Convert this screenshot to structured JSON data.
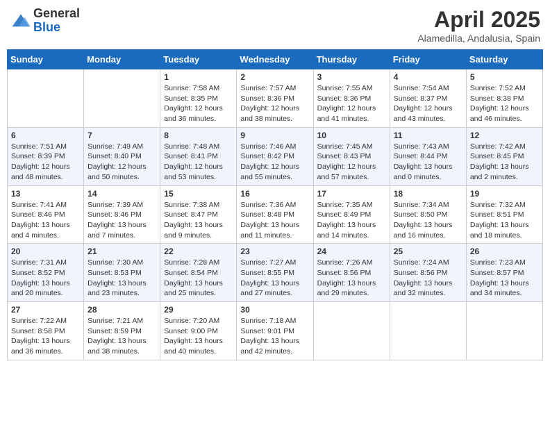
{
  "header": {
    "logo_general": "General",
    "logo_blue": "Blue",
    "month_title": "April 2025",
    "location": "Alamedilla, Andalusia, Spain"
  },
  "weekdays": [
    "Sunday",
    "Monday",
    "Tuesday",
    "Wednesday",
    "Thursday",
    "Friday",
    "Saturday"
  ],
  "weeks": [
    [
      {
        "day": "",
        "sunrise": "",
        "sunset": "",
        "daylight": ""
      },
      {
        "day": "",
        "sunrise": "",
        "sunset": "",
        "daylight": ""
      },
      {
        "day": "1",
        "sunrise": "Sunrise: 7:58 AM",
        "sunset": "Sunset: 8:35 PM",
        "daylight": "Daylight: 12 hours and 36 minutes."
      },
      {
        "day": "2",
        "sunrise": "Sunrise: 7:57 AM",
        "sunset": "Sunset: 8:36 PM",
        "daylight": "Daylight: 12 hours and 38 minutes."
      },
      {
        "day": "3",
        "sunrise": "Sunrise: 7:55 AM",
        "sunset": "Sunset: 8:36 PM",
        "daylight": "Daylight: 12 hours and 41 minutes."
      },
      {
        "day": "4",
        "sunrise": "Sunrise: 7:54 AM",
        "sunset": "Sunset: 8:37 PM",
        "daylight": "Daylight: 12 hours and 43 minutes."
      },
      {
        "day": "5",
        "sunrise": "Sunrise: 7:52 AM",
        "sunset": "Sunset: 8:38 PM",
        "daylight": "Daylight: 12 hours and 46 minutes."
      }
    ],
    [
      {
        "day": "6",
        "sunrise": "Sunrise: 7:51 AM",
        "sunset": "Sunset: 8:39 PM",
        "daylight": "Daylight: 12 hours and 48 minutes."
      },
      {
        "day": "7",
        "sunrise": "Sunrise: 7:49 AM",
        "sunset": "Sunset: 8:40 PM",
        "daylight": "Daylight: 12 hours and 50 minutes."
      },
      {
        "day": "8",
        "sunrise": "Sunrise: 7:48 AM",
        "sunset": "Sunset: 8:41 PM",
        "daylight": "Daylight: 12 hours and 53 minutes."
      },
      {
        "day": "9",
        "sunrise": "Sunrise: 7:46 AM",
        "sunset": "Sunset: 8:42 PM",
        "daylight": "Daylight: 12 hours and 55 minutes."
      },
      {
        "day": "10",
        "sunrise": "Sunrise: 7:45 AM",
        "sunset": "Sunset: 8:43 PM",
        "daylight": "Daylight: 12 hours and 57 minutes."
      },
      {
        "day": "11",
        "sunrise": "Sunrise: 7:43 AM",
        "sunset": "Sunset: 8:44 PM",
        "daylight": "Daylight: 13 hours and 0 minutes."
      },
      {
        "day": "12",
        "sunrise": "Sunrise: 7:42 AM",
        "sunset": "Sunset: 8:45 PM",
        "daylight": "Daylight: 13 hours and 2 minutes."
      }
    ],
    [
      {
        "day": "13",
        "sunrise": "Sunrise: 7:41 AM",
        "sunset": "Sunset: 8:46 PM",
        "daylight": "Daylight: 13 hours and 4 minutes."
      },
      {
        "day": "14",
        "sunrise": "Sunrise: 7:39 AM",
        "sunset": "Sunset: 8:46 PM",
        "daylight": "Daylight: 13 hours and 7 minutes."
      },
      {
        "day": "15",
        "sunrise": "Sunrise: 7:38 AM",
        "sunset": "Sunset: 8:47 PM",
        "daylight": "Daylight: 13 hours and 9 minutes."
      },
      {
        "day": "16",
        "sunrise": "Sunrise: 7:36 AM",
        "sunset": "Sunset: 8:48 PM",
        "daylight": "Daylight: 13 hours and 11 minutes."
      },
      {
        "day": "17",
        "sunrise": "Sunrise: 7:35 AM",
        "sunset": "Sunset: 8:49 PM",
        "daylight": "Daylight: 13 hours and 14 minutes."
      },
      {
        "day": "18",
        "sunrise": "Sunrise: 7:34 AM",
        "sunset": "Sunset: 8:50 PM",
        "daylight": "Daylight: 13 hours and 16 minutes."
      },
      {
        "day": "19",
        "sunrise": "Sunrise: 7:32 AM",
        "sunset": "Sunset: 8:51 PM",
        "daylight": "Daylight: 13 hours and 18 minutes."
      }
    ],
    [
      {
        "day": "20",
        "sunrise": "Sunrise: 7:31 AM",
        "sunset": "Sunset: 8:52 PM",
        "daylight": "Daylight: 13 hours and 20 minutes."
      },
      {
        "day": "21",
        "sunrise": "Sunrise: 7:30 AM",
        "sunset": "Sunset: 8:53 PM",
        "daylight": "Daylight: 13 hours and 23 minutes."
      },
      {
        "day": "22",
        "sunrise": "Sunrise: 7:28 AM",
        "sunset": "Sunset: 8:54 PM",
        "daylight": "Daylight: 13 hours and 25 minutes."
      },
      {
        "day": "23",
        "sunrise": "Sunrise: 7:27 AM",
        "sunset": "Sunset: 8:55 PM",
        "daylight": "Daylight: 13 hours and 27 minutes."
      },
      {
        "day": "24",
        "sunrise": "Sunrise: 7:26 AM",
        "sunset": "Sunset: 8:56 PM",
        "daylight": "Daylight: 13 hours and 29 minutes."
      },
      {
        "day": "25",
        "sunrise": "Sunrise: 7:24 AM",
        "sunset": "Sunset: 8:56 PM",
        "daylight": "Daylight: 13 hours and 32 minutes."
      },
      {
        "day": "26",
        "sunrise": "Sunrise: 7:23 AM",
        "sunset": "Sunset: 8:57 PM",
        "daylight": "Daylight: 13 hours and 34 minutes."
      }
    ],
    [
      {
        "day": "27",
        "sunrise": "Sunrise: 7:22 AM",
        "sunset": "Sunset: 8:58 PM",
        "daylight": "Daylight: 13 hours and 36 minutes."
      },
      {
        "day": "28",
        "sunrise": "Sunrise: 7:21 AM",
        "sunset": "Sunset: 8:59 PM",
        "daylight": "Daylight: 13 hours and 38 minutes."
      },
      {
        "day": "29",
        "sunrise": "Sunrise: 7:20 AM",
        "sunset": "Sunset: 9:00 PM",
        "daylight": "Daylight: 13 hours and 40 minutes."
      },
      {
        "day": "30",
        "sunrise": "Sunrise: 7:18 AM",
        "sunset": "Sunset: 9:01 PM",
        "daylight": "Daylight: 13 hours and 42 minutes."
      },
      {
        "day": "",
        "sunrise": "",
        "sunset": "",
        "daylight": ""
      },
      {
        "day": "",
        "sunrise": "",
        "sunset": "",
        "daylight": ""
      },
      {
        "day": "",
        "sunrise": "",
        "sunset": "",
        "daylight": ""
      }
    ]
  ]
}
